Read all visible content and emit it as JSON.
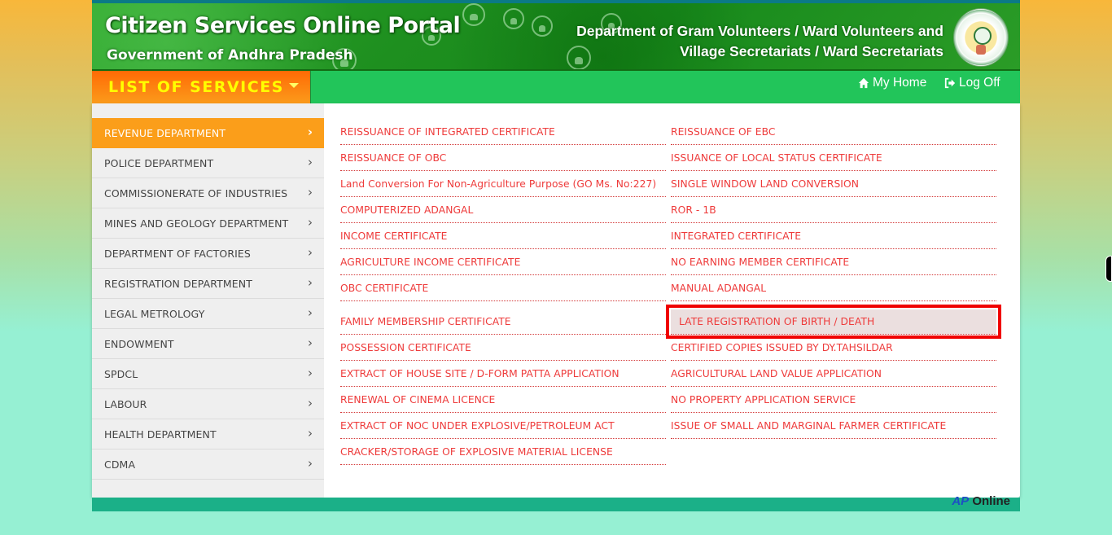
{
  "header": {
    "portal_title": "Citizen Services Online Portal",
    "portal_subtitle": "Government of Andhra Pradesh",
    "department_line1": "Department of Gram Volunteers / Ward Volunteers and",
    "department_line2": "Village Secretariats / Ward Secretariats",
    "emblem_icon": "ap-state-emblem"
  },
  "navbar": {
    "list_of_services_label": "LIST OF SERVICES",
    "dropdown_icon": "caret-down",
    "links": [
      {
        "label": "My Home",
        "icon": "home-icon"
      },
      {
        "label": "Log Off",
        "icon": "sign-out-icon"
      }
    ]
  },
  "sidebar": {
    "active_index": 0,
    "items": [
      {
        "label": "REVENUE DEPARTMENT"
      },
      {
        "label": "POLICE DEPARTMENT"
      },
      {
        "label": "COMMISSIONERATE OF INDUSTRIES"
      },
      {
        "label": "MINES AND GEOLOGY DEPARTMENT"
      },
      {
        "label": "DEPARTMENT OF FACTORIES"
      },
      {
        "label": "REGISTRATION DEPARTMENT"
      },
      {
        "label": "LEGAL METROLOGY"
      },
      {
        "label": "ENDOWMENT"
      },
      {
        "label": "SPDCL"
      },
      {
        "label": "LABOUR"
      },
      {
        "label": "HEALTH DEPARTMENT"
      },
      {
        "label": "CDMA"
      }
    ],
    "chevron_glyph": "›"
  },
  "services": {
    "left_column": [
      "REISSUANCE OF INTEGRATED CERTIFICATE",
      "REISSUANCE OF OBC",
      "Land Conversion For Non-Agriculture Purpose (GO Ms. No:227)",
      "COMPUTERIZED ADANGAL",
      "INCOME CERTIFICATE",
      "AGRICULTURE INCOME CERTIFICATE",
      "OBC CERTIFICATE",
      "FAMILY MEMBERSHIP CERTIFICATE",
      "POSSESSION CERTIFICATE",
      "EXTRACT OF HOUSE SITE / D-FORM PATTA APPLICATION",
      "RENEWAL OF CINEMA LICENCE",
      "EXTRACT OF NOC UNDER EXPLOSIVE/PETROLEUM ACT",
      "CRACKER/STORAGE OF EXPLOSIVE MATERIAL LICENSE"
    ],
    "right_column": [
      "REISSUANCE OF EBC",
      "ISSUANCE OF LOCAL STATUS CERTIFICATE",
      "SINGLE WINDOW LAND CONVERSION",
      "ROR - 1B",
      "INTEGRATED CERTIFICATE",
      "NO EARNING MEMBER CERTIFICATE",
      "MANUAL ADANGAL",
      "LATE REGISTRATION OF BIRTH / DEATH",
      "CERTIFIED COPIES ISSUED BY DY.TAHSILDAR",
      "AGRICULTURAL LAND VALUE APPLICATION",
      "NO PROPERTY APPLICATION SERVICE",
      "ISSUE OF SMALL AND MARGINAL FARMER CERTIFICATE"
    ],
    "highlighted": "LATE REGISTRATION OF BIRTH / DEATH"
  },
  "footer": {
    "logo_text_a": "AP",
    "logo_text_b": "Online"
  },
  "colors": {
    "accent_orange": "#fb9e1a",
    "nav_green": "#22c55a",
    "service_link_red": "#ee3b3b",
    "highlight_box_red": "#f00000",
    "footer_teal": "#1bb088"
  }
}
